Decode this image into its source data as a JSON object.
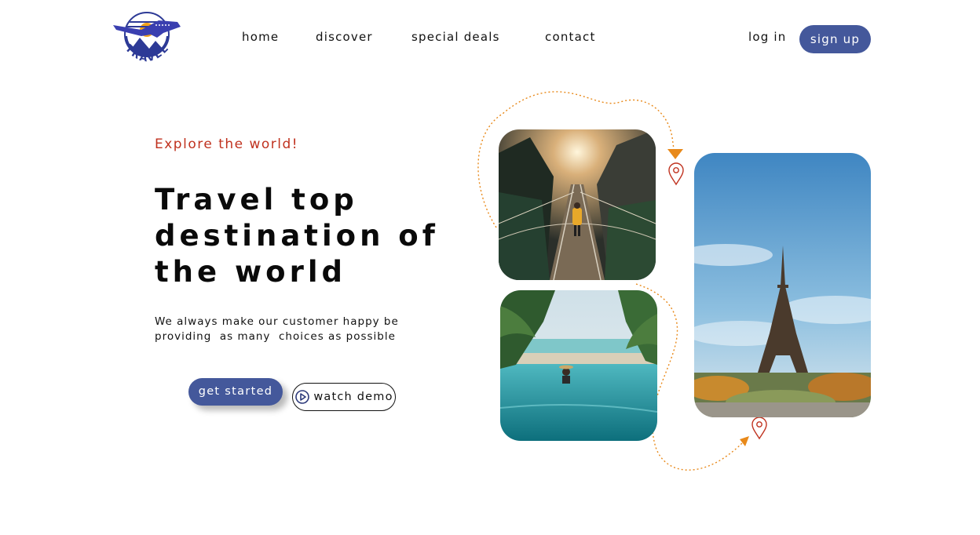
{
  "brand": {
    "logo_text": "TRAVEL"
  },
  "nav": {
    "items": [
      {
        "label": "home"
      },
      {
        "label": "discover"
      },
      {
        "label": "special deals"
      },
      {
        "label": "contact"
      }
    ],
    "login_label": "log in",
    "signup_label": "sign up"
  },
  "hero": {
    "tagline": "Explore the world!",
    "headline_lines": [
      "Travel top",
      "destination of",
      "the world"
    ],
    "description_lines": [
      "We always make our customer happy be",
      "providing  as many  choices as possible"
    ],
    "primary_cta": "get started",
    "secondary_cta": "watch demo"
  },
  "gallery": {
    "photos": [
      {
        "subject": "rope-bridge-photo"
      },
      {
        "subject": "infinity-pool-photo"
      },
      {
        "subject": "eiffel-tower-photo"
      }
    ]
  },
  "colors": {
    "accent": "#44589b",
    "tagline": "#c0321f",
    "route": "#e8891a",
    "pin": "#c0321f"
  }
}
